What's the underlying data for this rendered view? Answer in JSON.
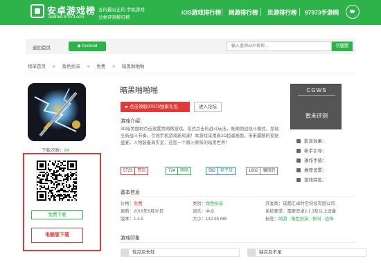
{
  "header": {
    "logo_title": "安卓游戏榜",
    "logo_domain": "android.97973.com",
    "slogan1": "业内最公正的 手机游戏",
    "slogan2": "分类评测排行榜",
    "nav": [
      "iOS游戏排行榜",
      "网游排行榜",
      "页游排行榜",
      "97973手游网"
    ]
  },
  "searchbar": {
    "back_home": "返回首页",
    "platform": "Android",
    "placeholder": "输入查询APP名称...",
    "search_label": "搜索"
  },
  "breadcrumb": [
    "榜单首页",
    "角色扮演",
    "免费",
    "暗黑啪啪啪"
  ],
  "app": {
    "title": "暗黑啪啪啪",
    "download_label": "下载次数：",
    "download_count": "94",
    "gift_label": "点击领取97973独家礼包",
    "forum_label": "进入论坛",
    "intro_title": "游戏介绍：",
    "intro_text": "3D暗黑题材点击放置类网络游戏。花式点击的战斗玩法，既颠倒战线斗模式，呈现全新战斗节奏，引领手机游戏新风潮！本游戏采用真3D超逼画面，带来震撼的视觉盛宴，人物装备真实呈，还您一个原汁原味的暗黑世界！",
    "free_download": "免费下载",
    "pc_download": "电脑版下载"
  },
  "badges": [
    {
      "count": "5723",
      "label": "赞玩",
      "color": "#e23a3a"
    },
    {
      "count": "724",
      "label": "嘀嘀",
      "color": "#2db34a"
    },
    {
      "count": "592",
      "label": "样子货",
      "color": "#2a8fd8"
    },
    {
      "count": "1602",
      "label": "骗钱的",
      "color": "#888888"
    }
  ],
  "basic_info": {
    "title": "基本信息",
    "price_label": "价格：",
    "price": "免费",
    "updated": "更新：2016年6月30日",
    "version": "版本：1.3.5",
    "category_label": "类别：",
    "category": "角色扮演",
    "language": "语言：中文",
    "size": "大小：142.95 MB",
    "developer": "开发商：成都汇卓时空科技有限公司",
    "system": "系统要求：需要安卓2.1.3及以上设备",
    "tags_label": "标签：",
    "tags": "网游 · 角色扮演 · 休闲 · 恐怖"
  },
  "impression": {
    "title": "游戏印象",
    "pros": "优点及长处",
    "cons": "缺点及不足"
  },
  "rating": {
    "header": "CGWS",
    "status": "暂未评测"
  },
  "side_list": [
    "影音效果：",
    "新手引导：",
    "操作手感：",
    "推荐设置：",
    "游戏特色："
  ]
}
